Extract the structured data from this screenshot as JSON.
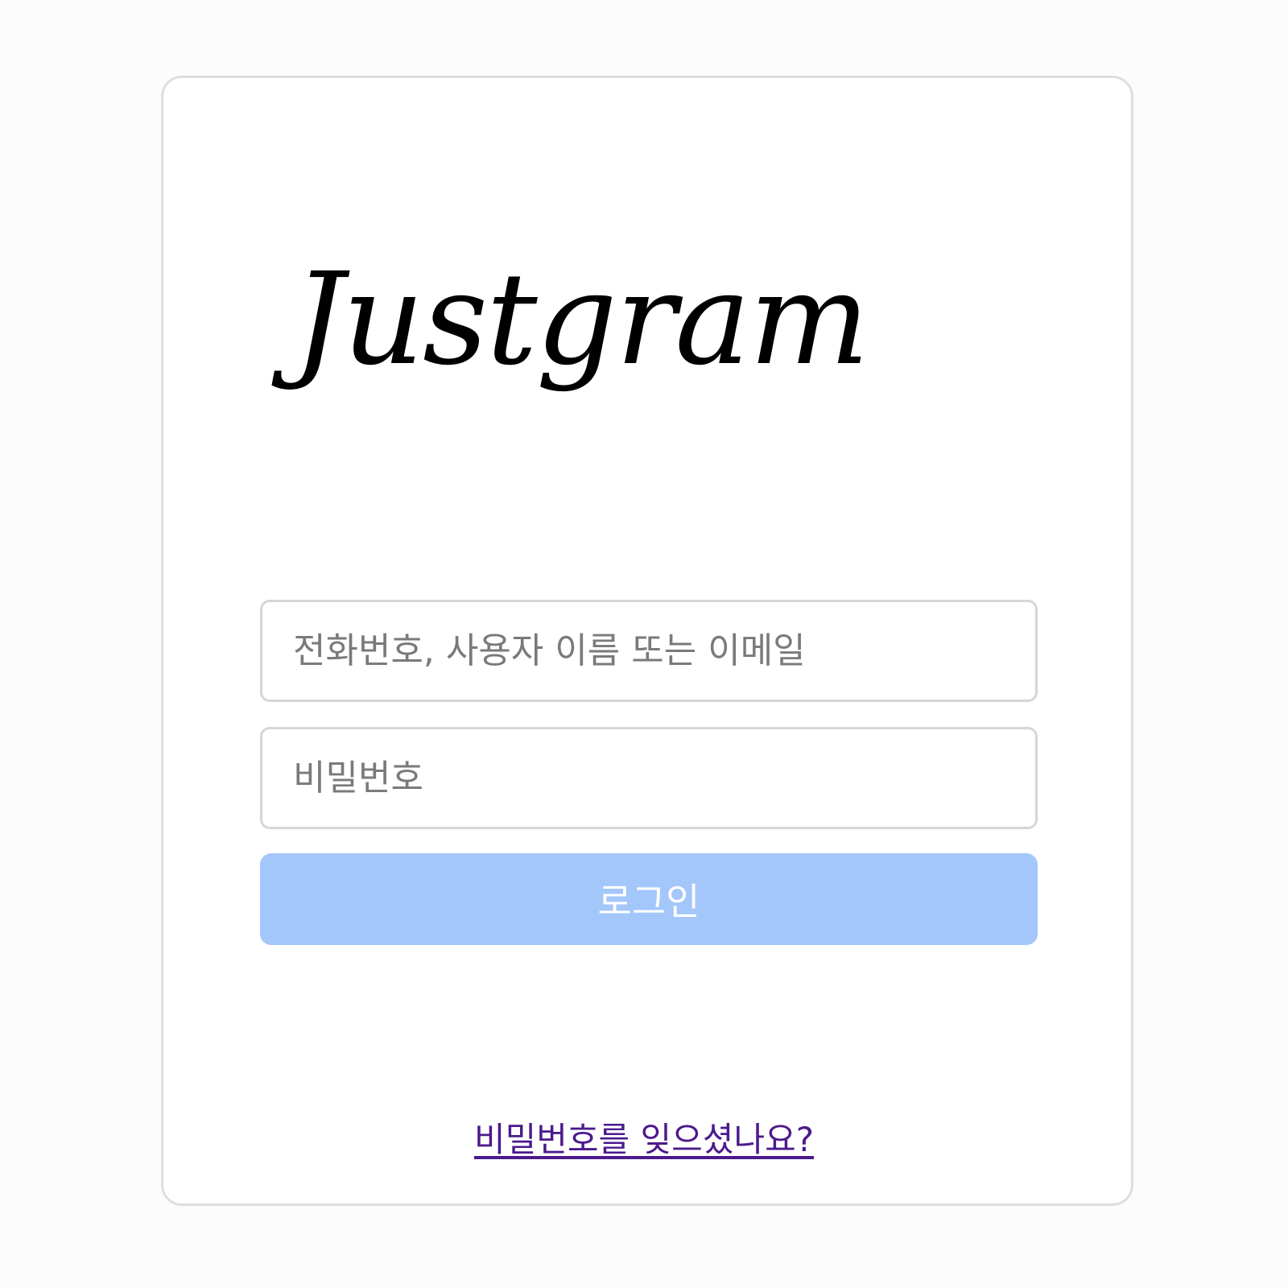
{
  "app": {
    "logo_text": "Justgram"
  },
  "form": {
    "username_placeholder": "전화번호, 사용자 이름 또는 이메일",
    "password_placeholder": "비밀번호",
    "login_label": "로그인",
    "forgot_password_label": "비밀번호를 잊으셨나요?"
  },
  "colors": {
    "button_bg": "#a3c6fb",
    "button_text": "#ffffff",
    "link": "#4b1a8c",
    "border": "#d6d6d6"
  }
}
